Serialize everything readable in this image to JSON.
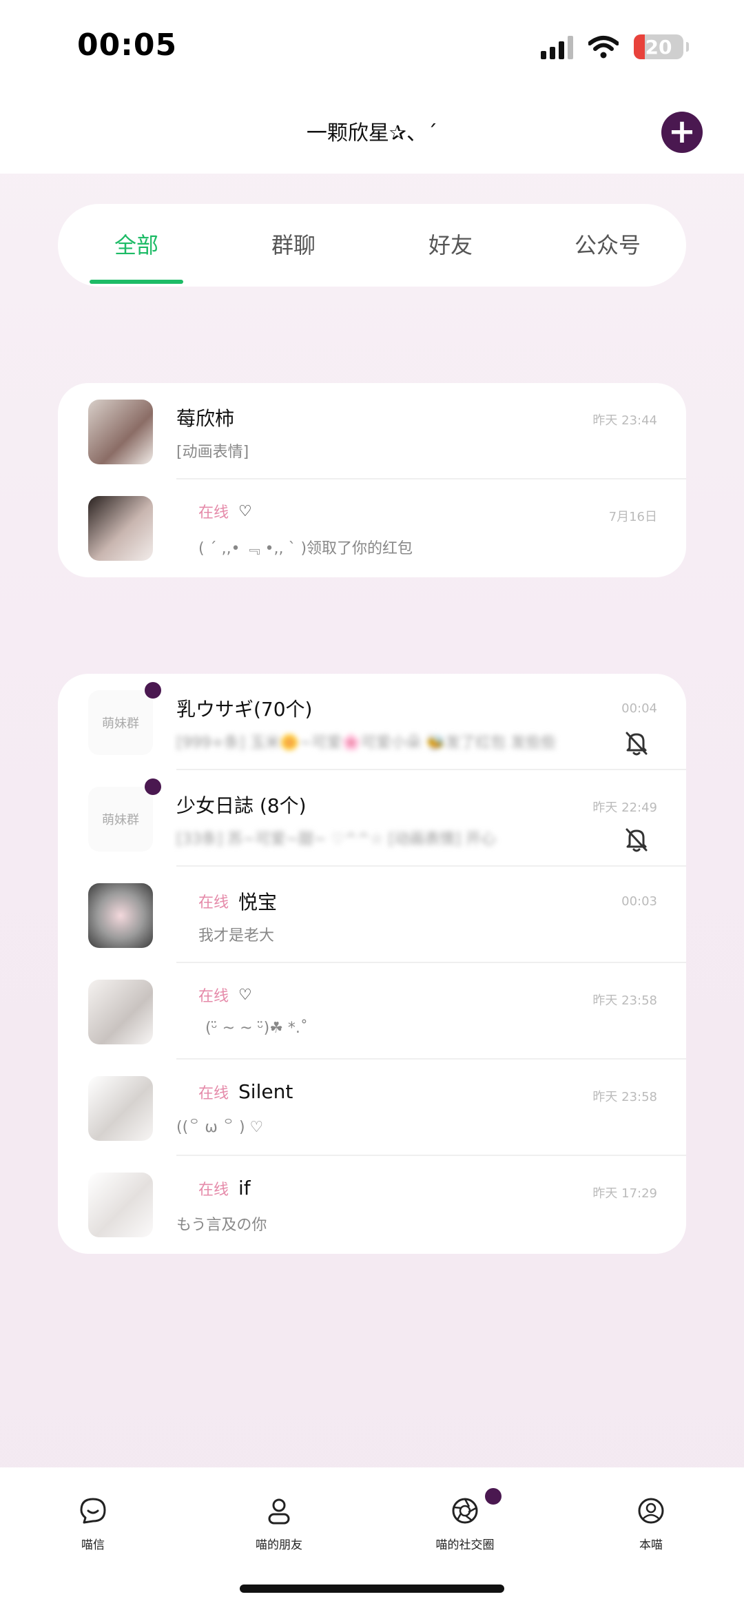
{
  "status_bar": {
    "time": "00:05",
    "battery": "20"
  },
  "header": {
    "title": "一颗欣星✰、´"
  },
  "tabs": [
    {
      "label": "全部",
      "active": true
    },
    {
      "label": "群聊",
      "active": false
    },
    {
      "label": "好友",
      "active": false
    },
    {
      "label": "公众号",
      "active": false
    }
  ],
  "pinned_chats": [
    {
      "name": "莓欣柿",
      "online": "",
      "heart": "",
      "message": "[动画表情]",
      "time": "昨天 23:44"
    },
    {
      "name": "",
      "online": "在线",
      "heart": "♡",
      "message": "( ˊ ,,• ﹃ •,, ˋ )领取了你的红包",
      "time": "7月16日"
    }
  ],
  "group_avatar_label": "萌妹群",
  "chats": [
    {
      "name": "乳ウサギ(70个)",
      "online": "",
      "heart": "",
      "message": "[999+条] 玉米🌼~可爱🌸可爱小朵 🐝发了红包 发些些",
      "time": "00:04",
      "muted": true,
      "unread_dot": true,
      "group": true
    },
    {
      "name": "少女日誌 (8个)",
      "online": "",
      "heart": "",
      "message": "[33条] 苏~可爱~甜~ ♡^^☆ [动画表情] 开心",
      "time": "昨天 22:49",
      "muted": true,
      "unread_dot": true,
      "group": true
    },
    {
      "name": "悦宝",
      "online": "在线",
      "heart": "",
      "message": "我才是老大",
      "time": "00:03",
      "muted": false,
      "unread_dot": false,
      "group": false
    },
    {
      "name": "",
      "online": "在线",
      "heart": "♡",
      "message": "(ᵕ̈ ~ ~ ᵕ̈)☘︎ *.˚",
      "time": "昨天 23:58",
      "muted": false,
      "unread_dot": false,
      "group": false
    },
    {
      "name": "Silent",
      "online": "在线",
      "heart": "",
      "message": "((꒪ ω ꒪ ) ♡",
      "time": "昨天 23:58",
      "muted": false,
      "unread_dot": false,
      "group": false
    },
    {
      "name": "if",
      "online": "在线",
      "heart": "",
      "message": "もう言及の你",
      "time": "昨天 17:29",
      "muted": false,
      "unread_dot": false,
      "group": false
    }
  ],
  "bottom_nav": [
    {
      "label": "喵信",
      "icon": "chat-icon"
    },
    {
      "label": "喵的朋友",
      "icon": "contacts-icon"
    },
    {
      "label": "喵的社交圈",
      "icon": "camera-shutter-icon",
      "dot": true
    },
    {
      "label": "本喵",
      "icon": "profile-icon"
    }
  ],
  "colors": {
    "accent_green": "#1dbb66",
    "dot_purple": "#4a1850",
    "online_pink": "#e58aa9",
    "background": "#f7eef5"
  }
}
